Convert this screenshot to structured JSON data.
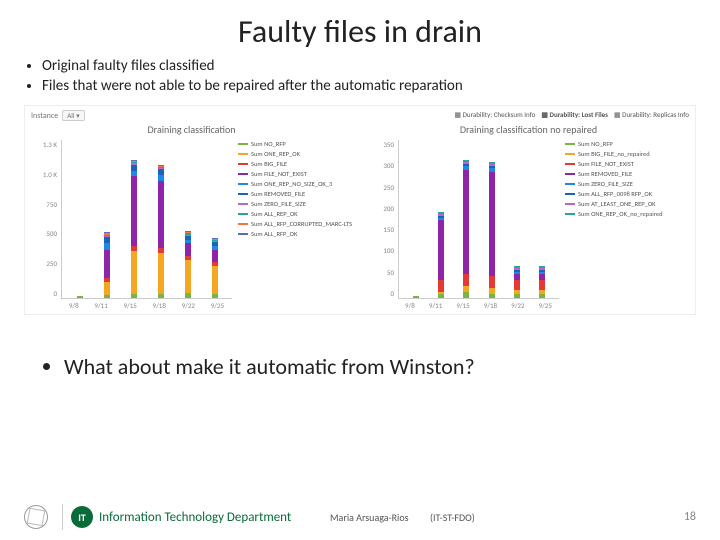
{
  "title": "Faulty files in drain",
  "bullets": [
    "Original faulty files classified",
    "Files that were not able to be repaired after the automatic reparation"
  ],
  "question": "What about make it automatic from Winston?",
  "footer": {
    "it_badge": "IT",
    "dept": "Information Technology Department",
    "author": "Maria Arsuaga-Rios",
    "dept_code": "(IT-ST-FDO)",
    "page": "18"
  },
  "left_panel": {
    "instance_label": "Instance",
    "instance_value": "All ▾",
    "title": "Draining classification",
    "y_ticks": [
      "1.3 K",
      "1.0 K",
      "750",
      "500",
      "250",
      "0"
    ],
    "x_ticks": [
      "9/8",
      "9/11",
      "9/15",
      "9/18",
      "9/22",
      "9/25"
    ],
    "legend": [
      {
        "label": "Sum NO_RFP",
        "color": "#7cb342"
      },
      {
        "label": "Sum ONE_REP_OK",
        "color": "#f5a623"
      },
      {
        "label": "Sum BIG_FILE",
        "color": "#e53935"
      },
      {
        "label": "Sum FILE_NOT_EXIST",
        "color": "#8e24aa"
      },
      {
        "label": "Sum ONE_REP_NO_SIZE_OK_3",
        "color": "#1e88e5"
      },
      {
        "label": "Sum REMOVED_FILE",
        "color": "#1565c0"
      },
      {
        "label": "Sum ZERO_FILE_SIZE",
        "color": "#ba68c8"
      },
      {
        "label": "Sum ALL_REP_OK",
        "color": "#26a69a"
      },
      {
        "label": "Sum ALL_RFP_CORRUPTED_MARC-LTS_NOT_SITE",
        "color": "#ff7043"
      },
      {
        "label": "Sum ALL_RFP_OK",
        "color": "#5c6bc0"
      }
    ]
  },
  "right_panel": {
    "tabs": [
      {
        "label": "Durability: Checksum Info",
        "active": false
      },
      {
        "label": "Durability: Lost Files",
        "active": true
      },
      {
        "label": "Durability: Replicas Info",
        "active": false
      }
    ],
    "title": "Draining classification no repaired",
    "y_ticks": [
      "350",
      "300",
      "250",
      "200",
      "150",
      "100",
      "50",
      "0"
    ],
    "x_ticks": [
      "9/8",
      "9/11",
      "9/15",
      "9/18",
      "9/22",
      "9/25"
    ],
    "legend": [
      {
        "label": "Sum NO_RFP",
        "color": "#7cb342"
      },
      {
        "label": "Sum BIG_FILE_no_repaired",
        "color": "#f5a623"
      },
      {
        "label": "Sum FILE_NOT_EXIST",
        "color": "#e53935"
      },
      {
        "label": "Sum REMOVED_FILE",
        "color": "#8e24aa"
      },
      {
        "label": "Sum ZERO_FILE_SIZE",
        "color": "#1e88e5"
      },
      {
        "label": "Sum ALL_RFP_0098 RFP_OK",
        "color": "#1565c0"
      },
      {
        "label": "Sum AT_LEAST_ONE_REP_OK",
        "color": "#ba68c8"
      },
      {
        "label": "Sum ONE_REP_OK_no_repaired",
        "color": "#26a69a"
      }
    ]
  },
  "chart_data": [
    {
      "type": "bar",
      "title": "Draining classification",
      "stacked": true,
      "categories": [
        "9/8",
        "9/11",
        "9/15",
        "9/18",
        "9/22",
        "9/25"
      ],
      "ylim": [
        0,
        1300
      ],
      "series": [
        {
          "name": "Sum NO_RFP",
          "color": "#7cb342",
          "values": [
            20,
            30,
            40,
            40,
            50,
            40
          ]
        },
        {
          "name": "Sum ONE_REP_OK",
          "color": "#f5a623",
          "values": [
            0,
            120,
            400,
            380,
            300,
            260
          ]
        },
        {
          "name": "Sum BIG_FILE",
          "color": "#e53935",
          "values": [
            0,
            40,
            40,
            40,
            40,
            30
          ]
        },
        {
          "name": "Sum FILE_NOT_EXIST",
          "color": "#8e24aa",
          "values": [
            0,
            260,
            650,
            630,
            120,
            120
          ]
        },
        {
          "name": "Sum ONE_REP_NO_SIZE_OK_3",
          "color": "#1e88e5",
          "values": [
            0,
            60,
            50,
            50,
            30,
            30
          ]
        },
        {
          "name": "Sum REMOVED_FILE",
          "color": "#1565c0",
          "values": [
            0,
            60,
            60,
            60,
            40,
            40
          ]
        },
        {
          "name": "Sum ZERO_FILE_SIZE",
          "color": "#ba68c8",
          "values": [
            0,
            10,
            10,
            10,
            10,
            10
          ]
        },
        {
          "name": "Sum ALL_REP_OK",
          "color": "#26a69a",
          "values": [
            0,
            10,
            10,
            10,
            10,
            10
          ]
        },
        {
          "name": "Sum ALL_RFP_CORRUPTED_MARC-LTS_NOT_SITE",
          "color": "#ff7043",
          "values": [
            0,
            10,
            10,
            10,
            10,
            10
          ]
        },
        {
          "name": "Sum ALL_RFP_OK",
          "color": "#5c6bc0",
          "values": [
            0,
            10,
            10,
            10,
            10,
            10
          ]
        }
      ]
    },
    {
      "type": "bar",
      "title": "Draining classification no repaired",
      "stacked": true,
      "categories": [
        "9/8",
        "9/11",
        "9/15",
        "9/18",
        "9/22",
        "9/25"
      ],
      "ylim": [
        0,
        350
      ],
      "series": [
        {
          "name": "Sum NO_RFP",
          "color": "#7cb342",
          "values": [
            5,
            10,
            15,
            10,
            10,
            10
          ]
        },
        {
          "name": "Sum BIG_FILE_no_repaired",
          "color": "#f5a623",
          "values": [
            0,
            5,
            15,
            15,
            10,
            10
          ]
        },
        {
          "name": "Sum FILE_NOT_EXIST",
          "color": "#e53935",
          "values": [
            0,
            30,
            30,
            30,
            25,
            25
          ]
        },
        {
          "name": "Sum REMOVED_FILE",
          "color": "#8e24aa",
          "values": [
            0,
            150,
            260,
            260,
            15,
            15
          ]
        },
        {
          "name": "Sum ZERO_FILE_SIZE",
          "color": "#1e88e5",
          "values": [
            0,
            5,
            10,
            10,
            5,
            5
          ]
        },
        {
          "name": "Sum ALL_RFP_0098 RFP_OK",
          "color": "#1565c0",
          "values": [
            0,
            5,
            5,
            5,
            5,
            5
          ]
        },
        {
          "name": "Sum AT_LEAST_ONE_REP_OK",
          "color": "#ba68c8",
          "values": [
            0,
            5,
            5,
            5,
            5,
            5
          ]
        },
        {
          "name": "Sum ONE_REP_OK_no_repaired",
          "color": "#26a69a",
          "values": [
            0,
            5,
            5,
            5,
            5,
            5
          ]
        }
      ]
    }
  ]
}
